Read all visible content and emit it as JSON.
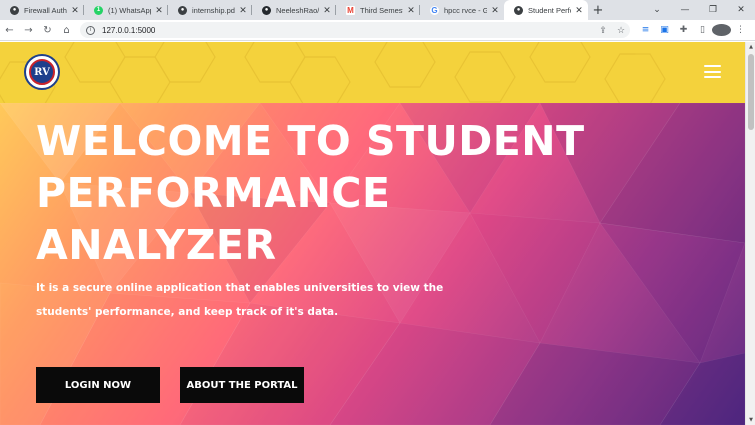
{
  "browser": {
    "tabs": [
      {
        "title": "Firewall Authe",
        "icon": "globe-icon",
        "color": "#3c4043",
        "active": false
      },
      {
        "title": "(1) WhatsApp",
        "icon": "whatsapp-icon",
        "color": "#25d366",
        "active": false
      },
      {
        "title": "internship.pdf",
        "icon": "globe-icon",
        "color": "#3c4043",
        "active": false
      },
      {
        "title": "NeeleshRao/St",
        "icon": "github-icon",
        "color": "#24292e",
        "active": false
      },
      {
        "title": "Third Semeste",
        "icon": "gmail-icon",
        "color": "#ea4335",
        "active": false
      },
      {
        "title": "hpcc rvce - Go",
        "icon": "google-icon",
        "color": "#4285f4",
        "active": false
      },
      {
        "title": "Student Perfor",
        "icon": "globe-icon",
        "color": "#3c4043",
        "active": true
      }
    ],
    "new_tab": "+",
    "url": "127.0.0.1:5000",
    "profile_initial": "N"
  },
  "site": {
    "logo_text": "RV",
    "hero_title": "WELCOME TO STUDENT PERFORMANCE ANALYZER",
    "hero_subtitle": "It is a secure online application that enables universities to view the students' performance, and keep track of it's data.",
    "login_button": "LOGIN NOW",
    "about_button": "ABOUT THE PORTAL"
  },
  "colors": {
    "header": "#f4d23c",
    "button": "#0a0a0a",
    "logo_blue": "#1e3f8c",
    "logo_red": "#c8232c"
  }
}
